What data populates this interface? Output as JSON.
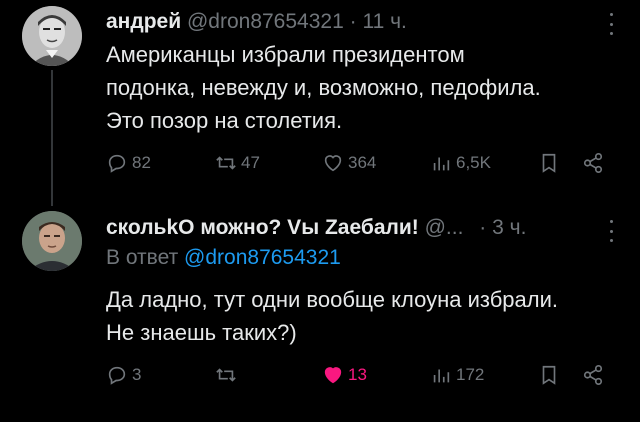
{
  "tweets": [
    {
      "author_name": "андрей",
      "handle": "@dron87654321",
      "separator": "·",
      "time": "11 ч.",
      "text_lines": [
        "Американцы избрали президентом",
        "подонка, невежду и, возможно, педофила.",
        "Это позор на столетия."
      ],
      "replies": "82",
      "reposts": "47",
      "likes": "364",
      "views": "6,5K"
    },
    {
      "author_name": "скольkО можно? Vы Zаебали!",
      "handle": "@...",
      "separator": "·",
      "time": "3 ч.",
      "reply_prefix": "В ответ",
      "reply_mention": "@dron87654321",
      "text_lines": [
        "Да ладно, тут одни вообще клоуна избрали.",
        "Не знаешь таких?)"
      ],
      "replies": "3",
      "reposts": "",
      "likes": "13",
      "views": "172",
      "liked": true
    }
  ],
  "colors": {
    "background": "#000000",
    "text": "#e7e9ea",
    "muted": "#71767b",
    "link": "#1d9bf0",
    "like_active": "#f91880"
  },
  "icons": [
    "reply-icon",
    "repost-icon",
    "like-icon",
    "views-icon",
    "bookmark-icon",
    "share-icon",
    "more-icon"
  ]
}
